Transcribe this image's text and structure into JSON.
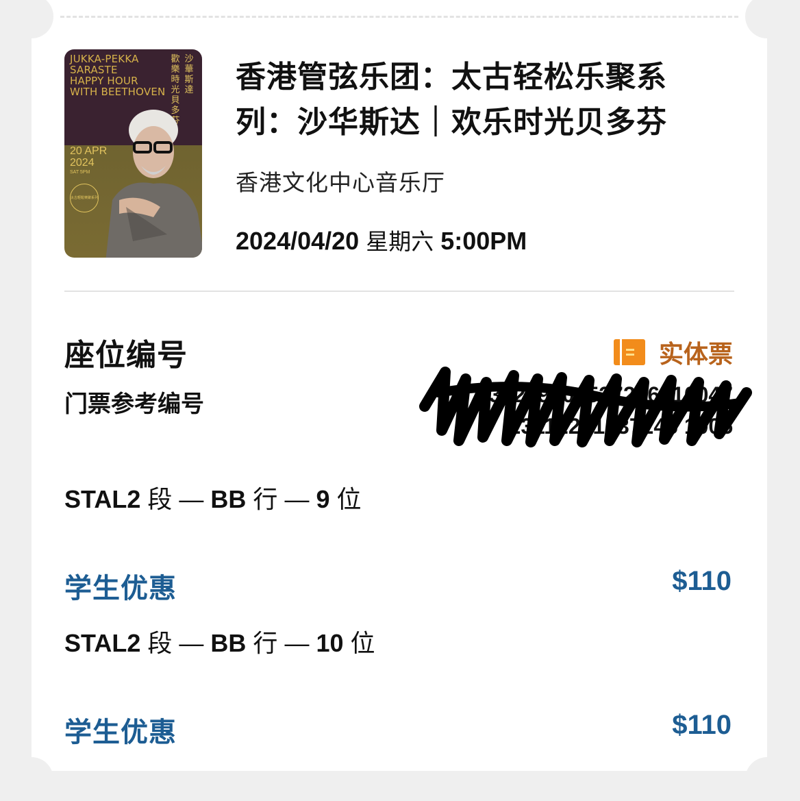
{
  "event": {
    "title_line1": "香港管弦乐团：太古轻松乐聚系",
    "title_line2": "列：沙华斯达｜欢乐时光贝多芬",
    "venue": "香港文化中心音乐厅",
    "date": "2024/04/20",
    "weekday": "星期六",
    "time": "5:00PM"
  },
  "poster": {
    "title": "JUKKA-PEKKA\nSARASTE\nHAPPY HOUR\nWITH BEETHOVEN",
    "cn_title_col1": "沙\n華\n斯\n達",
    "cn_title_col2": "歡\n樂\n時\n光\n貝\n多\n芬",
    "date": "20 APR\n2024",
    "time": "SAT 5PM",
    "badge": "太古輕鬆樂聚系列"
  },
  "seat_section": {
    "heading": "座位编号",
    "ticket_type": "实体票",
    "ref_label": "门票参考编号",
    "ref_value_1": "231229101537246010047",
    "ref_value_2": "23112251537246 1005"
  },
  "tickets": [
    {
      "section": "STAL2",
      "section_unit": "段",
      "row": "BB",
      "row_unit": "行",
      "seat": "9",
      "seat_unit": "位",
      "discount": "学生优惠",
      "price": "$110"
    },
    {
      "section": "STAL2",
      "section_unit": "段",
      "row": "BB",
      "row_unit": "行",
      "seat": "10",
      "seat_unit": "位",
      "discount": "学生优惠",
      "price": "$110"
    }
  ],
  "colors": {
    "accent_blue": "#1d5d93",
    "ticket_orange": "#b8631c",
    "icon_orange": "#f28c1b"
  }
}
